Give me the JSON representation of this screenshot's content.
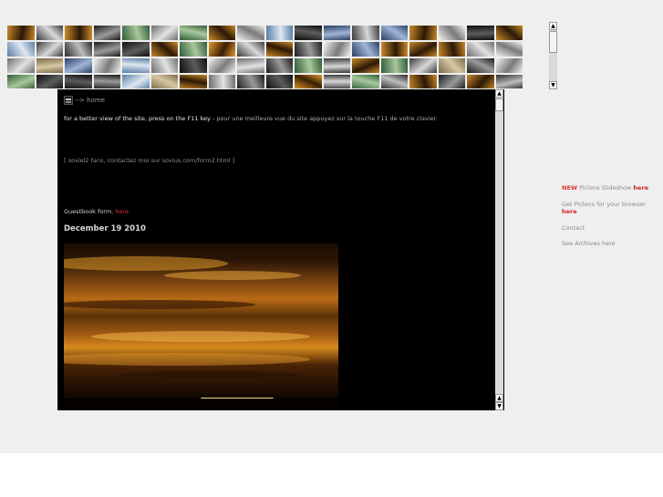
{
  "main": {
    "home_label": "--> home",
    "f11_en": "for a better view of the site, press on the F11 key",
    "f11_sep": " - ",
    "f11_fr": "pour une meilleure vue du site appuyez sur la touche F11 de votre clavier.",
    "contact_line": "[ soviel2 fans, contactez moi sur sovius.com/form2.html ]",
    "guestbook_label": "Guestbook form.",
    "guestbook_link": "here",
    "post_date": "December 19 2010"
  },
  "sidebar": {
    "new_tag": "NEW",
    "slideshow_label": "Piclens Slideshow",
    "slideshow_link": "here",
    "get_piclens_label": "Get Piclens for your browser",
    "get_piclens_link": "here",
    "contact_label": "Contact",
    "archives_label": "See Archives here"
  },
  "icons": {
    "home": "home-icon",
    "scroll_up": "up-arrow-icon",
    "scroll_down": "down-arrow-icon"
  },
  "colors": {
    "page_bg": "#efefef",
    "main_bg": "#000000",
    "link_red": "#cc2222"
  }
}
